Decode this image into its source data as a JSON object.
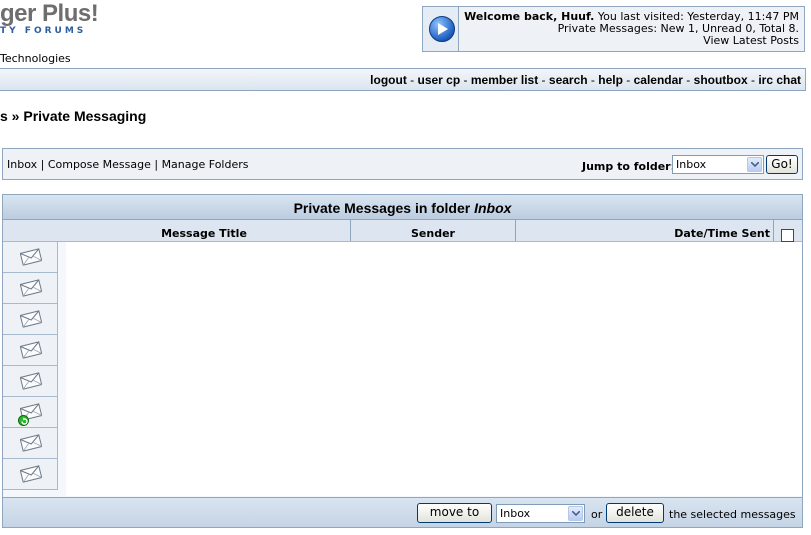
{
  "logo": {
    "title": "ger Plus!",
    "subtitle": "TY FORUMS"
  },
  "tech_line": "Technologies",
  "welcome": {
    "greeting_bold": "Welcome back, Huuf.",
    "last_visited": "You last visited: Yesterday, 11:47 PM",
    "pm_status": "Private Messages: New 1, Unread 0, Total 8.",
    "latest_posts": "View Latest Posts"
  },
  "nav": {
    "logout": "logout",
    "user_cp": "user cp",
    "member_list": "member list",
    "search": "search",
    "help": "help",
    "calendar": "calendar",
    "shoutbox": "shoutbox",
    "irc_chat": "irc chat",
    "separator": " - "
  },
  "breadcrumb": "s » Private Messaging",
  "pm_toolbar": {
    "inbox": "Inbox",
    "compose": "Compose Message",
    "manage": "Manage Folders",
    "divider": " | ",
    "jump_label": "Jump to folder:",
    "jump_value": "Inbox",
    "go_label": "Go!"
  },
  "table": {
    "title_prefix": "Private Messages in folder ",
    "title_folder": "Inbox",
    "columns": {
      "title": "Message Title",
      "sender": "Sender",
      "date": "Date/Time Sent"
    },
    "rows": [
      {
        "status": "read"
      },
      {
        "status": "read"
      },
      {
        "status": "read"
      },
      {
        "status": "read"
      },
      {
        "status": "read"
      },
      {
        "status": "new"
      },
      {
        "status": "read"
      },
      {
        "status": "read"
      }
    ],
    "bottom": {
      "move_to_label": "move to",
      "move_to_value": "Inbox",
      "or": "or",
      "delete_label": "delete",
      "selected_text": "the selected messages"
    }
  },
  "colors": {
    "border": "#8fa6c1",
    "header_bg": "#d9e4f0",
    "new_badge": "#2db52d"
  }
}
